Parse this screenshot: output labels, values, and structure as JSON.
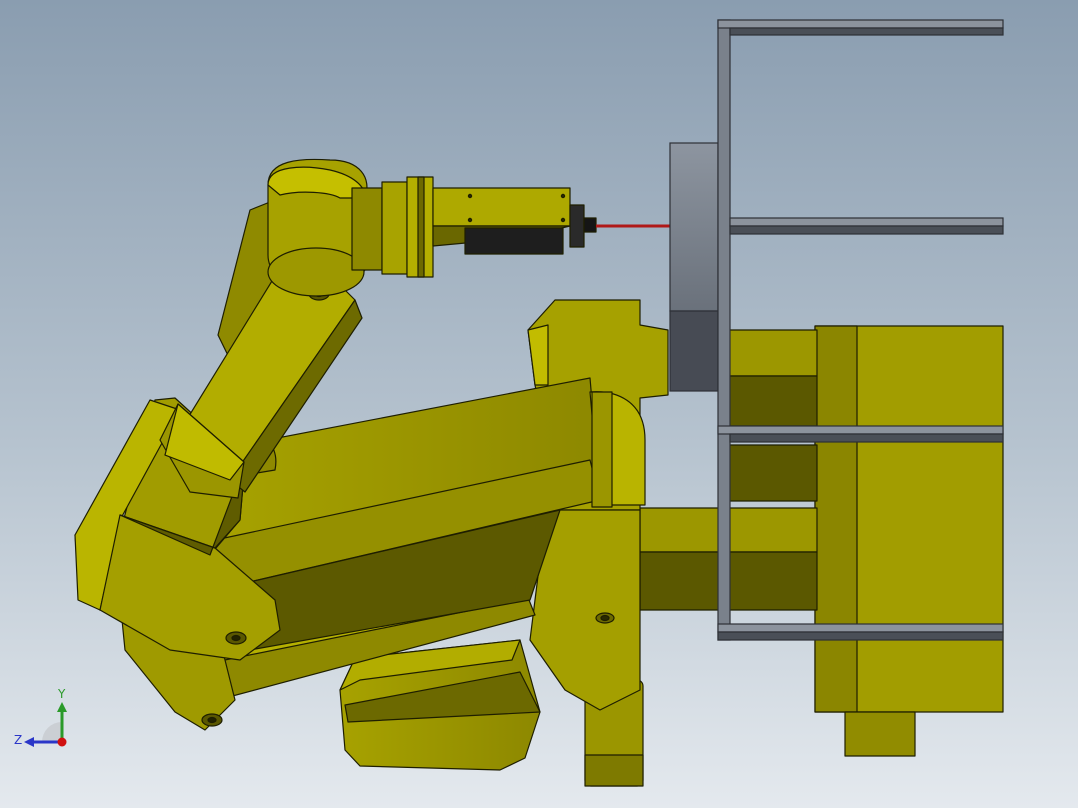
{
  "viewport": {
    "background_top": "#8a9db0",
    "background_bottom": "#e4e9ee"
  },
  "model": {
    "robot_color": "#a9a400",
    "frame_color": "#6e7580",
    "laser_color": "#b01818"
  },
  "triad": {
    "y_label": "Y",
    "z_label": "Z",
    "y_color": "#2a9a2a",
    "z_color": "#2a36c8",
    "x_color": "#d01010"
  }
}
